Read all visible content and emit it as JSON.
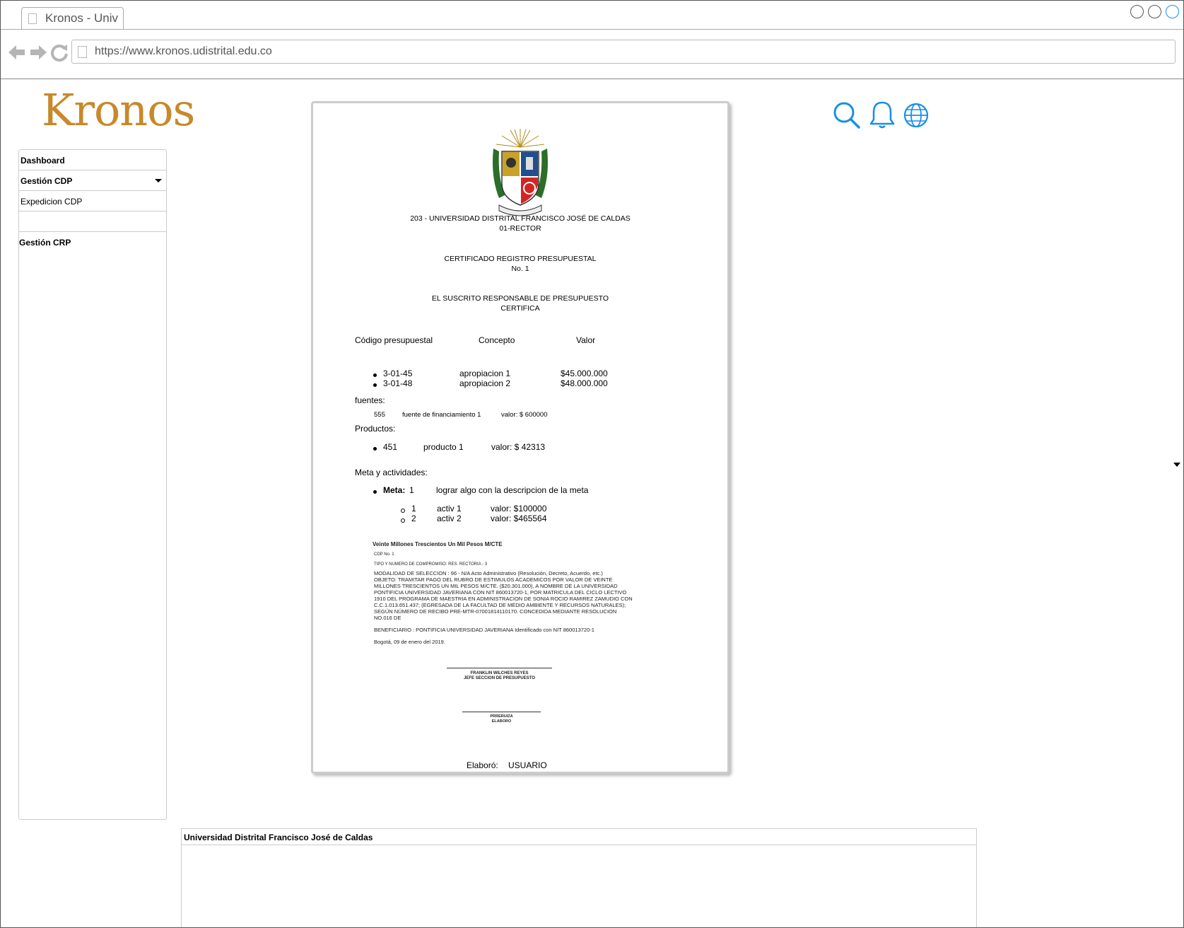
{
  "browser": {
    "tab_title": "Kronos - Univ",
    "url": "https://www.kronos.udistrital.edu.co"
  },
  "logo": {
    "text": "Kronos"
  },
  "sidebar": {
    "items": [
      {
        "label": "Dashboard"
      },
      {
        "label": "Gestión CDP"
      },
      {
        "label": "Expedicion CDP"
      },
      {
        "label": ""
      },
      {
        "label": "Gestión CRP"
      }
    ]
  },
  "document": {
    "entity": "203 - UNIVERSIDAD DISTRITAL FRANCISCO JOSÉ DE CALDAS",
    "dependency": "01-RECTOR",
    "title": "CERTIFICADO REGISTRO PRESUPUESTAL",
    "number": "No. 1",
    "subscribed": "EL SUSCRITO RESPONSABLE DE PRESUPUESTO",
    "certifies": "CERTIFICA",
    "table_headers": [
      "Código presupuestal",
      "Concepto",
      "Valor"
    ],
    "rows": [
      {
        "code": "3-01-45",
        "concept": "apropiacion 1",
        "value": "$45.000.000"
      },
      {
        "code": "3-01-48",
        "concept": "apropiacion 2",
        "value": "$48.000.000"
      }
    ],
    "fuentes_label": "fuentes:",
    "fuente": {
      "code": "555",
      "name": "fuente de financiamiento 1",
      "value": "valor: $ 600000"
    },
    "productos_label": "Productos:",
    "producto": {
      "code": "451",
      "name": "producto 1",
      "value": "valor: $ 42313"
    },
    "meta_label": "Meta y actividades:",
    "meta": {
      "label": "Meta:",
      "number": "1",
      "description": "lograr algo con la descripcion de la meta"
    },
    "activities": [
      {
        "num": "1",
        "name": "activ 1",
        "value": "valor: $100000"
      },
      {
        "num": "2",
        "name": "activ 2",
        "value": "valor: $465564"
      }
    ],
    "scan": {
      "amount_words": "Veinte Millones Trescientos Un Mil Pesos  M/CTE",
      "cdp": "CDP No. 1",
      "compromiso": "TIPO Y NUMERO DE COMPROMISO: RES. RECTORIA - 3",
      "lines": [
        "MODALIDAD DE SELECCION : 96 - N/A Acto Administrativo (Resolución, Decreto, Acuerdo, etc.)",
        "OBJETO: TRAMITAR  PAGO DEL RUBRO DE ESTIMULOS ACADEMICOS POR VALOR DE VEINTE",
        "MILLONES TRESCIENTOS UN MIL PESOS M/CTE. ($20.301.000), A NOMBRE DE LA UNIVERSIDAD",
        "PONTIFICIA UNIVERSIDAD JAVERIANA  CON NIT 860013720-1,  POR MATRICULA DEL CICLO LECTIVO",
        "1910  DEL  PROGRAMA DE MAESTRIA EN ADMINISTRACION DE SONIA ROCIO RAMIREZ ZAMUDIO  CON",
        "C.C.1.013.651.437; (EGRESADA DE LA FACULTAD DE MEDIO AMBIENTE Y RECURSOS NATURALES);",
        "SEGÚN NÚMERO DE RECIBO PRE-MTR-07001814110170.  CONCEDIDA MEDIANTE RESOLUCION",
        "NO.016 DE"
      ],
      "beneficiary": "BENEFICIARIO : PONTIFICIA UNIVERSIDAD JAVERIANA Identificado con NIT 860013720-1",
      "date": "Bogotá, 09 de enero del 2019.",
      "signer_name": "FRANKLIN WILCHES REYES",
      "signer_role": "JEFE SECCION DE PRESUPUESTO",
      "elaboro_name": "PRRERUIZA",
      "elaboro_role": "ELABORO"
    },
    "elaboro_label": "Elaboró:",
    "elaboro_user": "USUARIO"
  },
  "footer": {
    "title": "Universidad Distrital Francisco José de Caldas"
  },
  "colors": {
    "accent": "#1a8fe3",
    "logo": "#c8892a"
  },
  "icons": [
    "search-icon",
    "bell-icon",
    "globe-icon"
  ]
}
